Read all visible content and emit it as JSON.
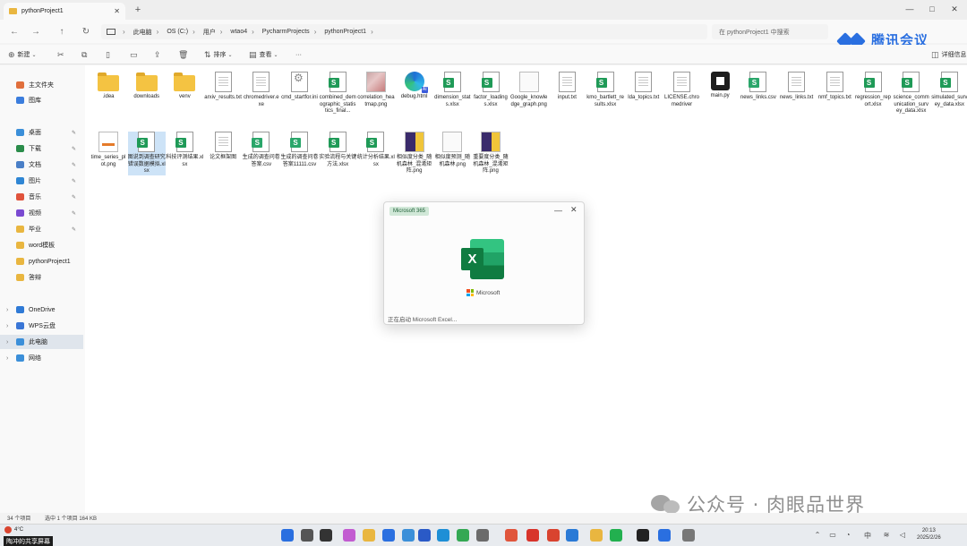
{
  "window": {
    "tab_title": "pythonProject1",
    "new_tab_symbol": "+",
    "controls": {
      "minimize": "—",
      "maximize": "□",
      "close": "✕"
    }
  },
  "address": {
    "crumbs": [
      "此电脑",
      "OS (C:)",
      "用户",
      "wtao4",
      "PycharmProjects",
      "pythonProject1"
    ],
    "search_placeholder": "在 pythonProject1 中搜索"
  },
  "brand": {
    "text": "腾讯会议"
  },
  "toolbar": {
    "new": "新建",
    "sort": "排序",
    "view": "查看",
    "more": "···",
    "details": "详细信息"
  },
  "sidebar": {
    "items": [
      {
        "label": "主文件夹",
        "color": "#e06f3c"
      },
      {
        "label": "图库",
        "color": "#3b7ddd"
      },
      {
        "label": "桌面",
        "color": "#3b8fd9",
        "pinned": true
      },
      {
        "label": "下载",
        "color": "#2a8c4a",
        "pinned": true
      },
      {
        "label": "文档",
        "color": "#4a7fc7",
        "pinned": true
      },
      {
        "label": "图片",
        "color": "#2f86d4",
        "pinned": true
      },
      {
        "label": "音乐",
        "color": "#e0533c",
        "pinned": true
      },
      {
        "label": "视频",
        "color": "#7a4ad1",
        "pinned": true
      },
      {
        "label": "毕业",
        "color": "#e9b640",
        "pinned": true
      },
      {
        "label": "word模板",
        "color": "#e9b640"
      },
      {
        "label": "pythonProject1",
        "color": "#e9b640"
      },
      {
        "label": "答辩",
        "color": "#e9b640"
      },
      {
        "label": "OneDrive",
        "color": "#2f7ad6"
      },
      {
        "label": "WPS云盘",
        "color": "#3a76d6"
      },
      {
        "label": "此电脑",
        "color": "#3b8fd9"
      },
      {
        "label": "网络",
        "color": "#3b8fd9"
      }
    ],
    "pin_symbol": "✎"
  },
  "files": [
    {
      "name": ".idea",
      "type": "folder"
    },
    {
      "name": "downloads",
      "type": "folder"
    },
    {
      "name": "venv",
      "type": "folder"
    },
    {
      "name": "arxiv_results.txt",
      "type": "doc"
    },
    {
      "name": "chromedriver.exe",
      "type": "doc"
    },
    {
      "name": "cmd_startfor.ini",
      "type": "gear"
    },
    {
      "name": "combined_demographic_statistics_final...",
      "type": "sheet"
    },
    {
      "name": "correlation_heatmap.png",
      "type": "img-heat"
    },
    {
      "name": "debug.html",
      "type": "edge"
    },
    {
      "name": "dimension_stats.xlsx",
      "type": "sheet"
    },
    {
      "name": "factor_loadings.xlsx",
      "type": "sheet"
    },
    {
      "name": "Google_knowledge_graph.png",
      "type": "img-graph"
    },
    {
      "name": "input.txt",
      "type": "doc"
    },
    {
      "name": "kmo_bartlett_results.xlsx",
      "type": "sheet"
    },
    {
      "name": "lda_topics.txt",
      "type": "doc"
    },
    {
      "name": "LICENSE.chromedriver",
      "type": "doc"
    },
    {
      "name": "main.py",
      "type": "py"
    },
    {
      "name": "news_links.csv",
      "type": "csv"
    },
    {
      "name": "news_links.txt",
      "type": "doc"
    },
    {
      "name": "nmf_topics.txt",
      "type": "doc"
    },
    {
      "name": "regression_report.xlsx",
      "type": "sheet"
    },
    {
      "name": "science_communication_survey_data.xlsx",
      "type": "sheet"
    },
    {
      "name": "simulated_survey_data.xlsx",
      "type": "sheet"
    },
    {
      "name": "time_series_plot.png",
      "type": "img-plot"
    },
    {
      "name": "图说到调查研究错误数据模拟.xlsx",
      "type": "sheet",
      "selected": true
    },
    {
      "name": "科技评测结果.xlsx",
      "type": "sheet"
    },
    {
      "name": "论文框架图",
      "type": "doc"
    },
    {
      "name": "生成的调查问卷答案.csv",
      "type": "csv"
    },
    {
      "name": "生成的调查问卷答案11111.csv",
      "type": "csv"
    },
    {
      "name": "实验流程与关键方法.xlsx",
      "type": "sheet"
    },
    {
      "name": "统计分析结果.xlsx",
      "type": "sheet"
    },
    {
      "name": "相似度分类_随机森林_混淆矩阵.png",
      "type": "img-purple"
    },
    {
      "name": "相似度预测_随机森林.png",
      "type": "img-graph"
    },
    {
      "name": "重要度分类_随机森林_混淆矩阵.png",
      "type": "img-purple"
    }
  ],
  "dialog": {
    "tag": "Microsoft 365",
    "minimize": "—",
    "close": "✕",
    "app_letter": "X",
    "vendor": "Microsoft",
    "status": "正在启动 Microsoft Excel..."
  },
  "statusbar": {
    "count": "34 个项目",
    "selection": "选中 1 个项目  164 KB"
  },
  "taskbar": {
    "weather": "4°C",
    "share_badge": "陶冲的共享屏幕",
    "time": "20:13",
    "date": "2025/2/26"
  },
  "watermark": {
    "text": "公众号 · 肉眼品世界"
  }
}
